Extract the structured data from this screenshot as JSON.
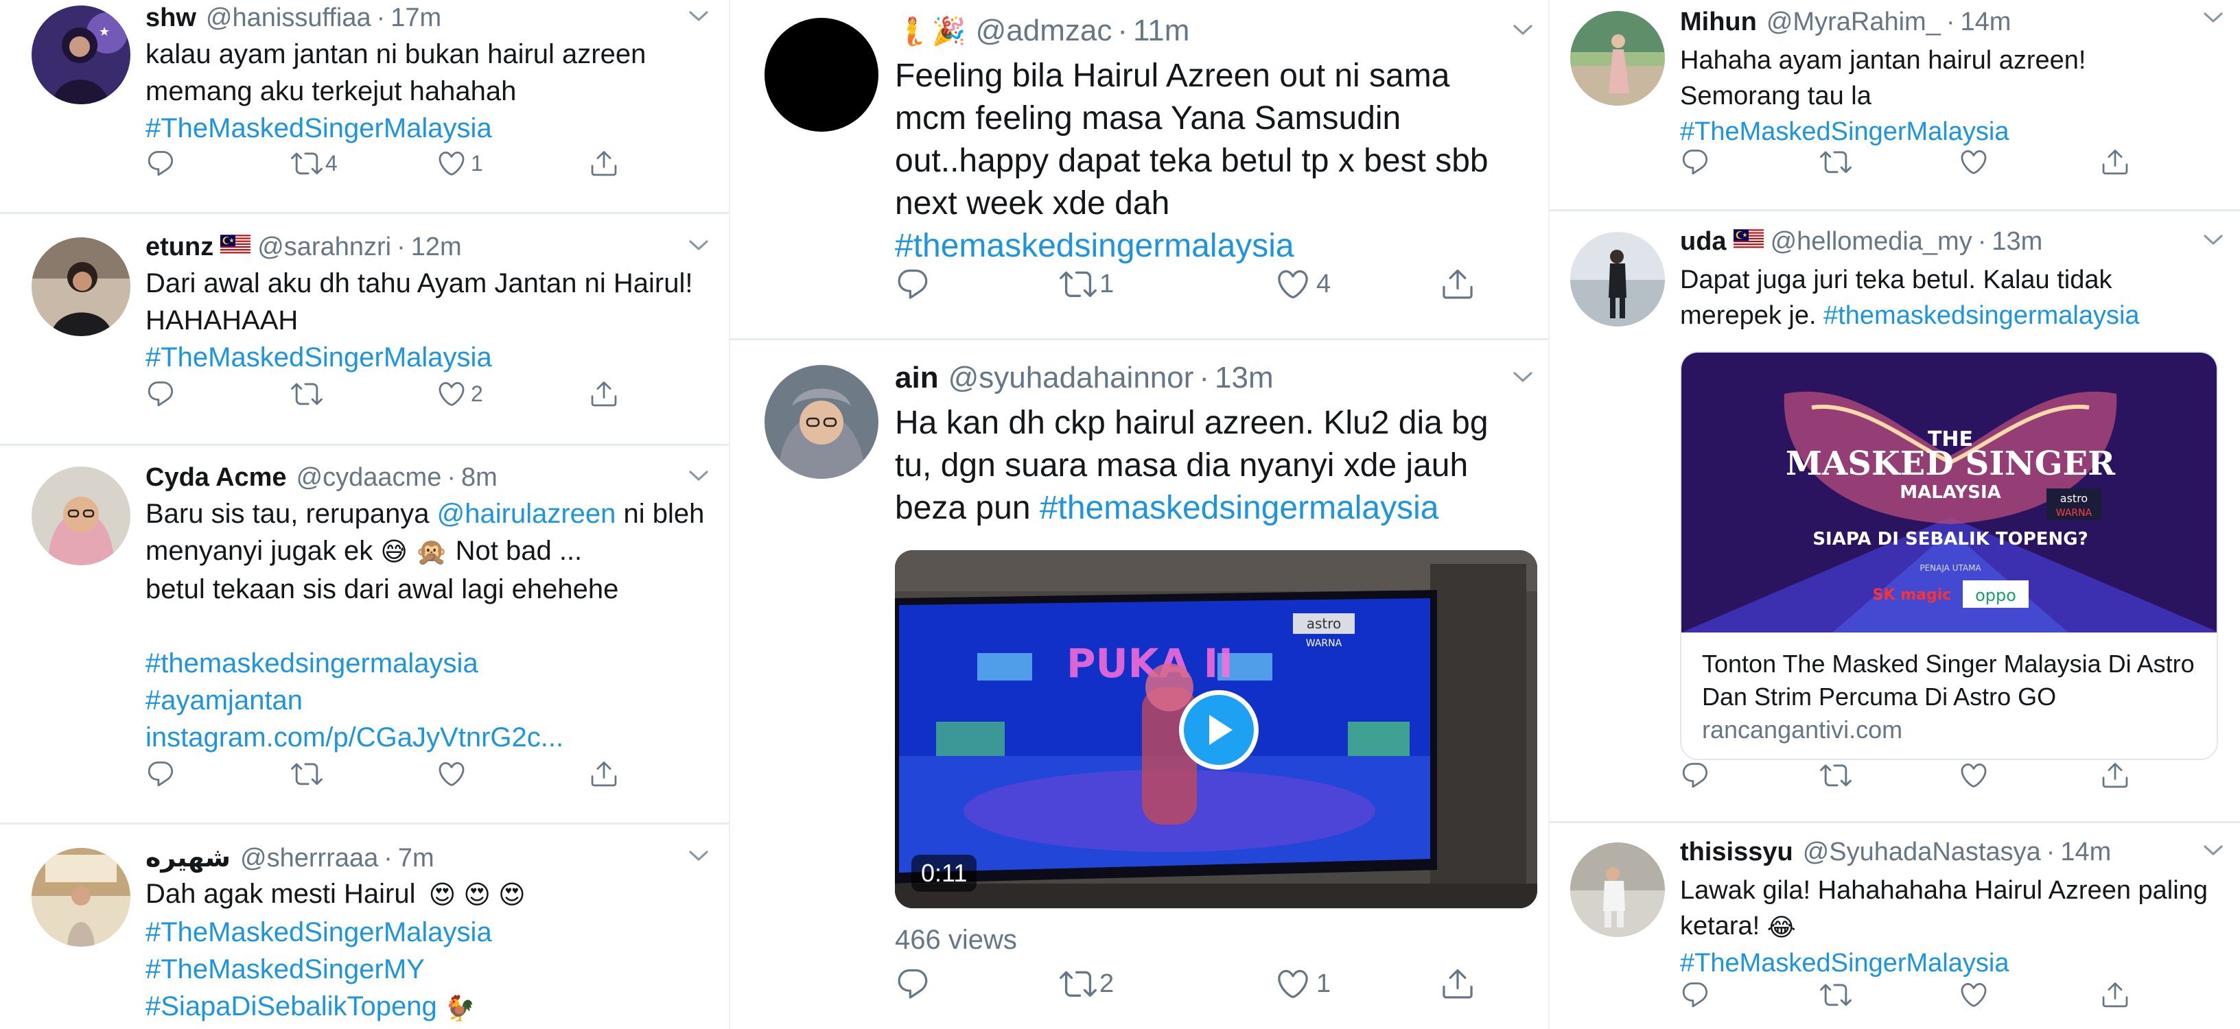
{
  "col1": [
    {
      "name": "shw",
      "handle": "@hanissuffiaa",
      "time": "17m",
      "text": "kalau ayam jantan ni bukan hairul azreen memang aku terkejut hahahah",
      "hashtags": [
        "#TheMaskedSingerMalaysia"
      ],
      "retweets": "4",
      "likes": "1"
    },
    {
      "name": "etunz",
      "handle": "@sarahnzri",
      "time": "12m",
      "text": "Dari awal aku dh tahu Ayam Jantan ni Hairul! HAHAHAAH",
      "hashtags": [
        "#TheMaskedSingerMalaysia"
      ],
      "retweets": "",
      "likes": "2"
    },
    {
      "name": "Cyda Acme",
      "handle": "@cydaacme",
      "time": "8m",
      "text_a": "Baru sis tau, rerupanya ",
      "mention": "@hairulazreen",
      "text_b": " ni bleh menyanyi jugak ek",
      "text_c": " Not bad ...",
      "text_d": "betul tekaan sis dari awal lagi ehehehe",
      "hashtag_1": "#themaskedsingermalaysia",
      "hashtag_2": "#ayamjantan",
      "link": "instagram.com/p/CGaJyVtnrG2c...",
      "retweets": "",
      "likes": ""
    },
    {
      "name": "شهيره",
      "handle": "@sherrraaa",
      "time": "7m",
      "text": "Dah agak mesti Hairul",
      "hashtags": [
        "#TheMaskedSingerMalaysia",
        "#TheMaskedSingerMY",
        "#SiapaDiSebalikTopeng"
      ]
    }
  ],
  "col2": [
    {
      "name": "",
      "handle": "@admzac",
      "time": "11m",
      "text": "Feeling bila Hairul Azreen out ni sama mcm feeling masa Yana Samsudin out..happy dapat teka betul tp x best sbb next week xde dah",
      "hashtag": "#themaskedsingermalaysia",
      "retweets": "1",
      "likes": "4"
    },
    {
      "name": "ain",
      "handle": "@syuhadahainnor",
      "time": "13m",
      "text": "Ha kan dh ckp hairul azreen. Klu2 dia bg tu, dgn suara masa dia nyanyi xde jauh beza pun ",
      "hashtag": "#themaskedsingermalaysia",
      "video_duration": "0:11",
      "video_tv_logo": "astro",
      "video_tv_channel": "WARNA",
      "video_screen_text": "PUKA II",
      "views": "466 views",
      "retweets": "2",
      "likes": "1"
    }
  ],
  "col3": [
    {
      "name": "Mihun",
      "handle": "@MyraRahim_",
      "time": "14m",
      "text": "Hahaha ayam jantan hairul azreen! Semorang tau la",
      "hashtag": "#TheMaskedSingerMalaysia"
    },
    {
      "name": "uda",
      "handle": "@hellomedia_my",
      "time": "13m",
      "text": "Dapat juga juri teka betul. Kalau tidak merepek je. ",
      "hashtag": "#themaskedsingermalaysia",
      "card_image_top": "THE",
      "card_image_title": "MASKED SINGER",
      "card_image_subtitle": "MALAYSIA",
      "card_image_tagline": "SIAPA DI SEBALIK TOPENG?",
      "card_image_sponsor_label": "PENAJA UTAMA",
      "card_image_sponsor_1": "SK magic",
      "card_image_sponsor_2": "oppo",
      "card_image_astro": "astro",
      "card_image_warna": "WARNA",
      "card_title": "Tonton The Masked Singer Malaysia Di Astro Dan Strim Percuma Di Astro GO",
      "card_domain": "rancangantivi.com"
    },
    {
      "name": "thisissyu",
      "handle": "@SyuhadaNastasya",
      "time": "14m",
      "text": "Lawak gila! Hahahahaha Hairul Azreen paling ketara!",
      "hashtag": "#TheMaskedSingerMalaysia"
    }
  ],
  "colors": {
    "text": "#14171a",
    "secondary": "#657786",
    "link": "#1b95e0",
    "divider": "#e6ecf0"
  }
}
